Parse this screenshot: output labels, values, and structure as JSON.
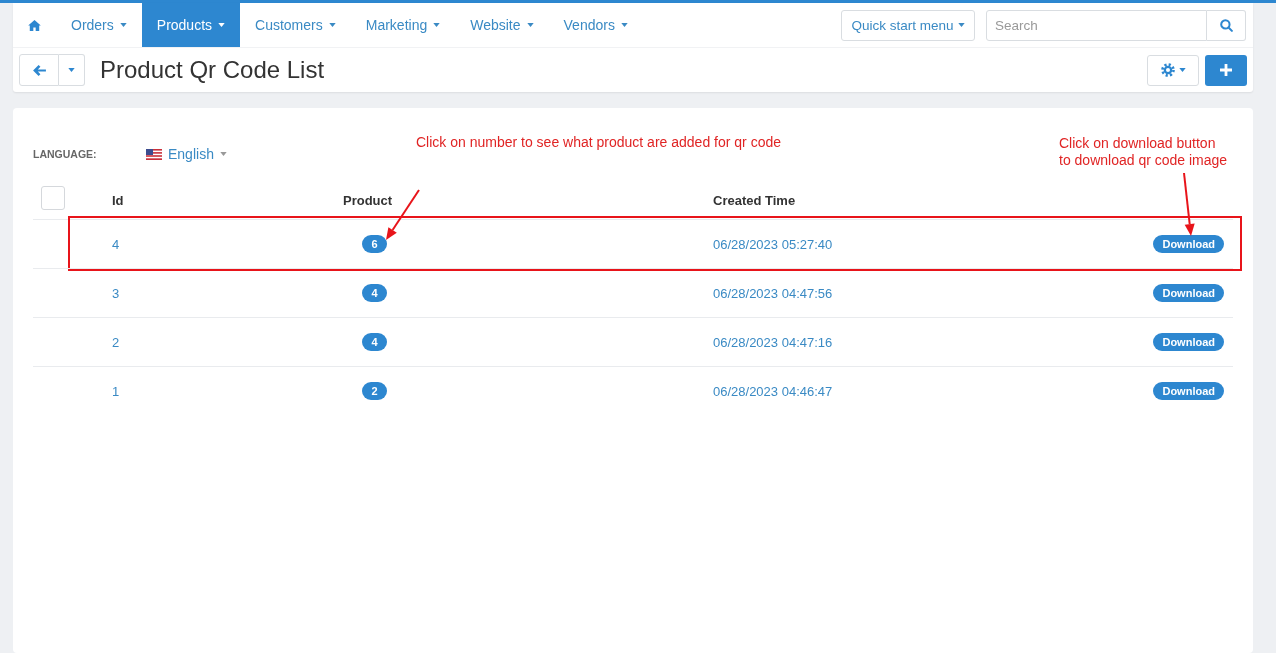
{
  "nav": {
    "items": [
      {
        "label": "Orders",
        "selected": false,
        "dropdown": true
      },
      {
        "label": "Products",
        "selected": true,
        "dropdown": true
      },
      {
        "label": "Customers",
        "selected": false,
        "dropdown": true
      },
      {
        "label": "Marketing",
        "selected": false,
        "dropdown": true
      },
      {
        "label": "Website",
        "selected": false,
        "dropdown": true
      },
      {
        "label": "Vendors",
        "selected": false,
        "dropdown": true
      }
    ]
  },
  "quick_start": {
    "label": "Quick start menu",
    "dropdown": true
  },
  "search": {
    "placeholder": "Search"
  },
  "page": {
    "title": "Product Qr Code List"
  },
  "language": {
    "label": "LANGUAGE:",
    "value": "English"
  },
  "annotations": [
    {
      "lines": [
        "Click on number to see what product are added for qr code"
      ]
    },
    {
      "lines": [
        "Click on download button",
        "to download qr code image"
      ]
    }
  ],
  "table": {
    "select_all": {
      "checked": false
    },
    "columns": [
      "Id",
      "Product",
      "Created Time"
    ],
    "rows": [
      {
        "id": "4",
        "product_count": "6",
        "created_time": "06/28/2023 05:27:40",
        "action": "Download",
        "highlighted": true
      },
      {
        "id": "3",
        "product_count": "4",
        "created_time": "06/28/2023 04:47:56",
        "action": "Download",
        "highlighted": false
      },
      {
        "id": "2",
        "product_count": "4",
        "created_time": "06/28/2023 04:47:16",
        "action": "Download",
        "highlighted": false
      },
      {
        "id": "1",
        "product_count": "2",
        "created_time": "06/28/2023 04:46:47",
        "action": "Download",
        "highlighted": false
      }
    ]
  }
}
